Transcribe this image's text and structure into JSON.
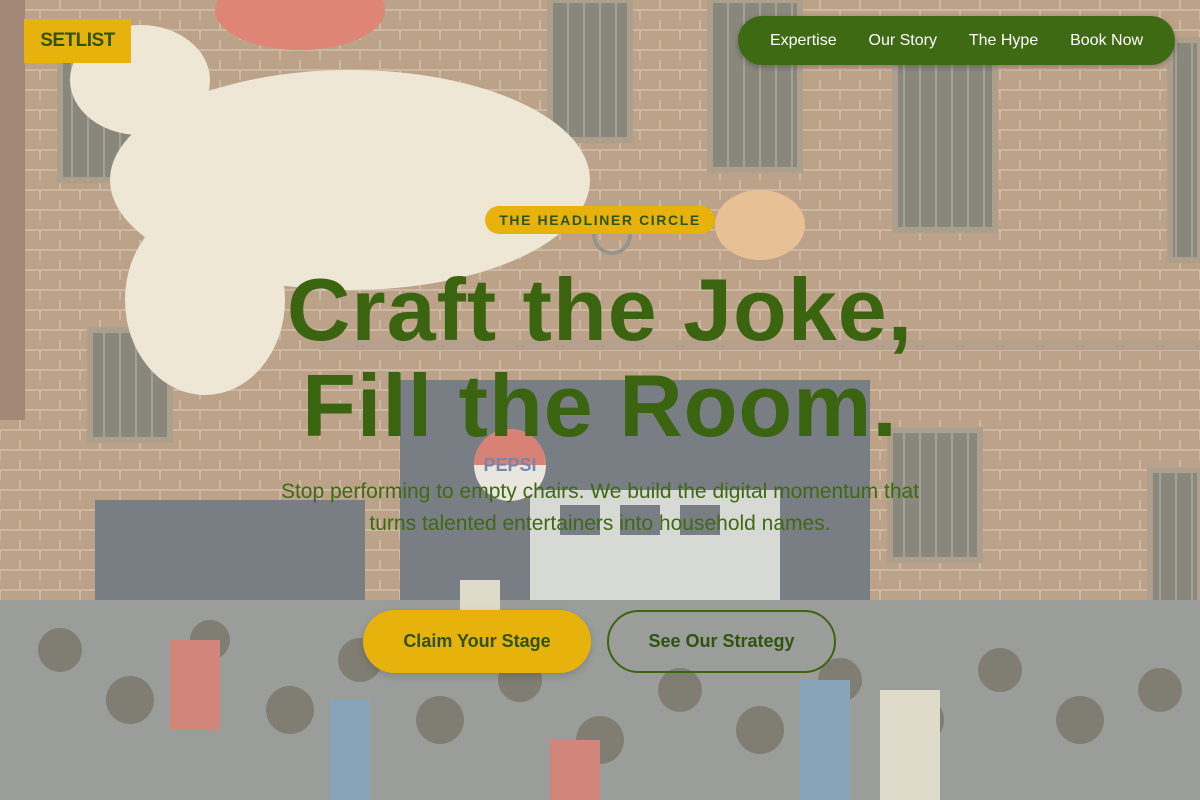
{
  "brand": {
    "logo_text": "SETLIST"
  },
  "nav": {
    "items": [
      "Expertise",
      "Our Story",
      "The Hype",
      "Book Now"
    ]
  },
  "hero": {
    "badge": "THE HEADLINER CIRCLE",
    "headline_line1": "Craft the Joke,",
    "headline_line2": "Fill the Room.",
    "subtext": "Stop performing to empty chairs. We build the digital momentum that turns talented entertainers into household names.",
    "primary_cta": "Claim Your Stage",
    "secondary_cta": "See Our Strategy"
  },
  "background": {
    "sign_text": "PEPSI"
  },
  "colors": {
    "accent_yellow": "#e8b20d",
    "brand_green": "#3f6a14",
    "headline_green": "#3b6410"
  }
}
